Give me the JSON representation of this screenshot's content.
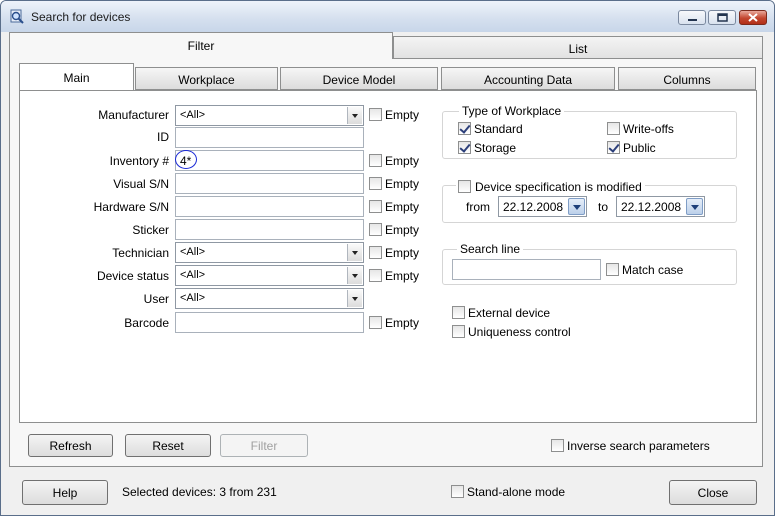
{
  "window": {
    "title": "Search for devices"
  },
  "outer_tabs": [
    {
      "label": "Filter"
    },
    {
      "label": "List"
    }
  ],
  "inner_tabs": [
    {
      "label": "Main"
    },
    {
      "label": "Workplace"
    },
    {
      "label": "Device Model"
    },
    {
      "label": "Accounting Data"
    },
    {
      "label": "Columns"
    }
  ],
  "empty_label": "Empty",
  "form": {
    "manufacturer": {
      "label": "Manufacturer",
      "value": "<All>"
    },
    "id": {
      "label": "ID",
      "value": ""
    },
    "inventory": {
      "label": "Inventory #",
      "value": "4*"
    },
    "visual_sn": {
      "label": "Visual S/N",
      "value": ""
    },
    "hardware_sn": {
      "label": "Hardware S/N",
      "value": ""
    },
    "sticker": {
      "label": "Sticker",
      "value": ""
    },
    "technician": {
      "label": "Technician",
      "value": "<All>"
    },
    "device_status": {
      "label": "Device status",
      "value": "<All>"
    },
    "user": {
      "label": "User",
      "value": "<All>"
    },
    "barcode": {
      "label": "Barcode",
      "value": ""
    }
  },
  "type_of_workplace": {
    "title": "Type of Workplace",
    "standard": "Standard",
    "storage": "Storage",
    "write_offs": "Write-offs",
    "public": "Public"
  },
  "device_spec": {
    "title": "Device specification is modified",
    "from_label": "from",
    "from_value": "22.12.2008",
    "to_label": "to",
    "to_value": "22.12.2008"
  },
  "search_line": {
    "title": "Search line",
    "value": "",
    "match_case": "Match case"
  },
  "external_device": "External device",
  "uniqueness_control": "Uniqueness control",
  "buttons": {
    "refresh": "Refresh",
    "reset": "Reset",
    "filter": "Filter",
    "help": "Help",
    "close": "Close"
  },
  "inverse_search": "Inverse search parameters",
  "status": "Selected devices: 3 from 231",
  "standalone_mode": "Stand-alone mode"
}
